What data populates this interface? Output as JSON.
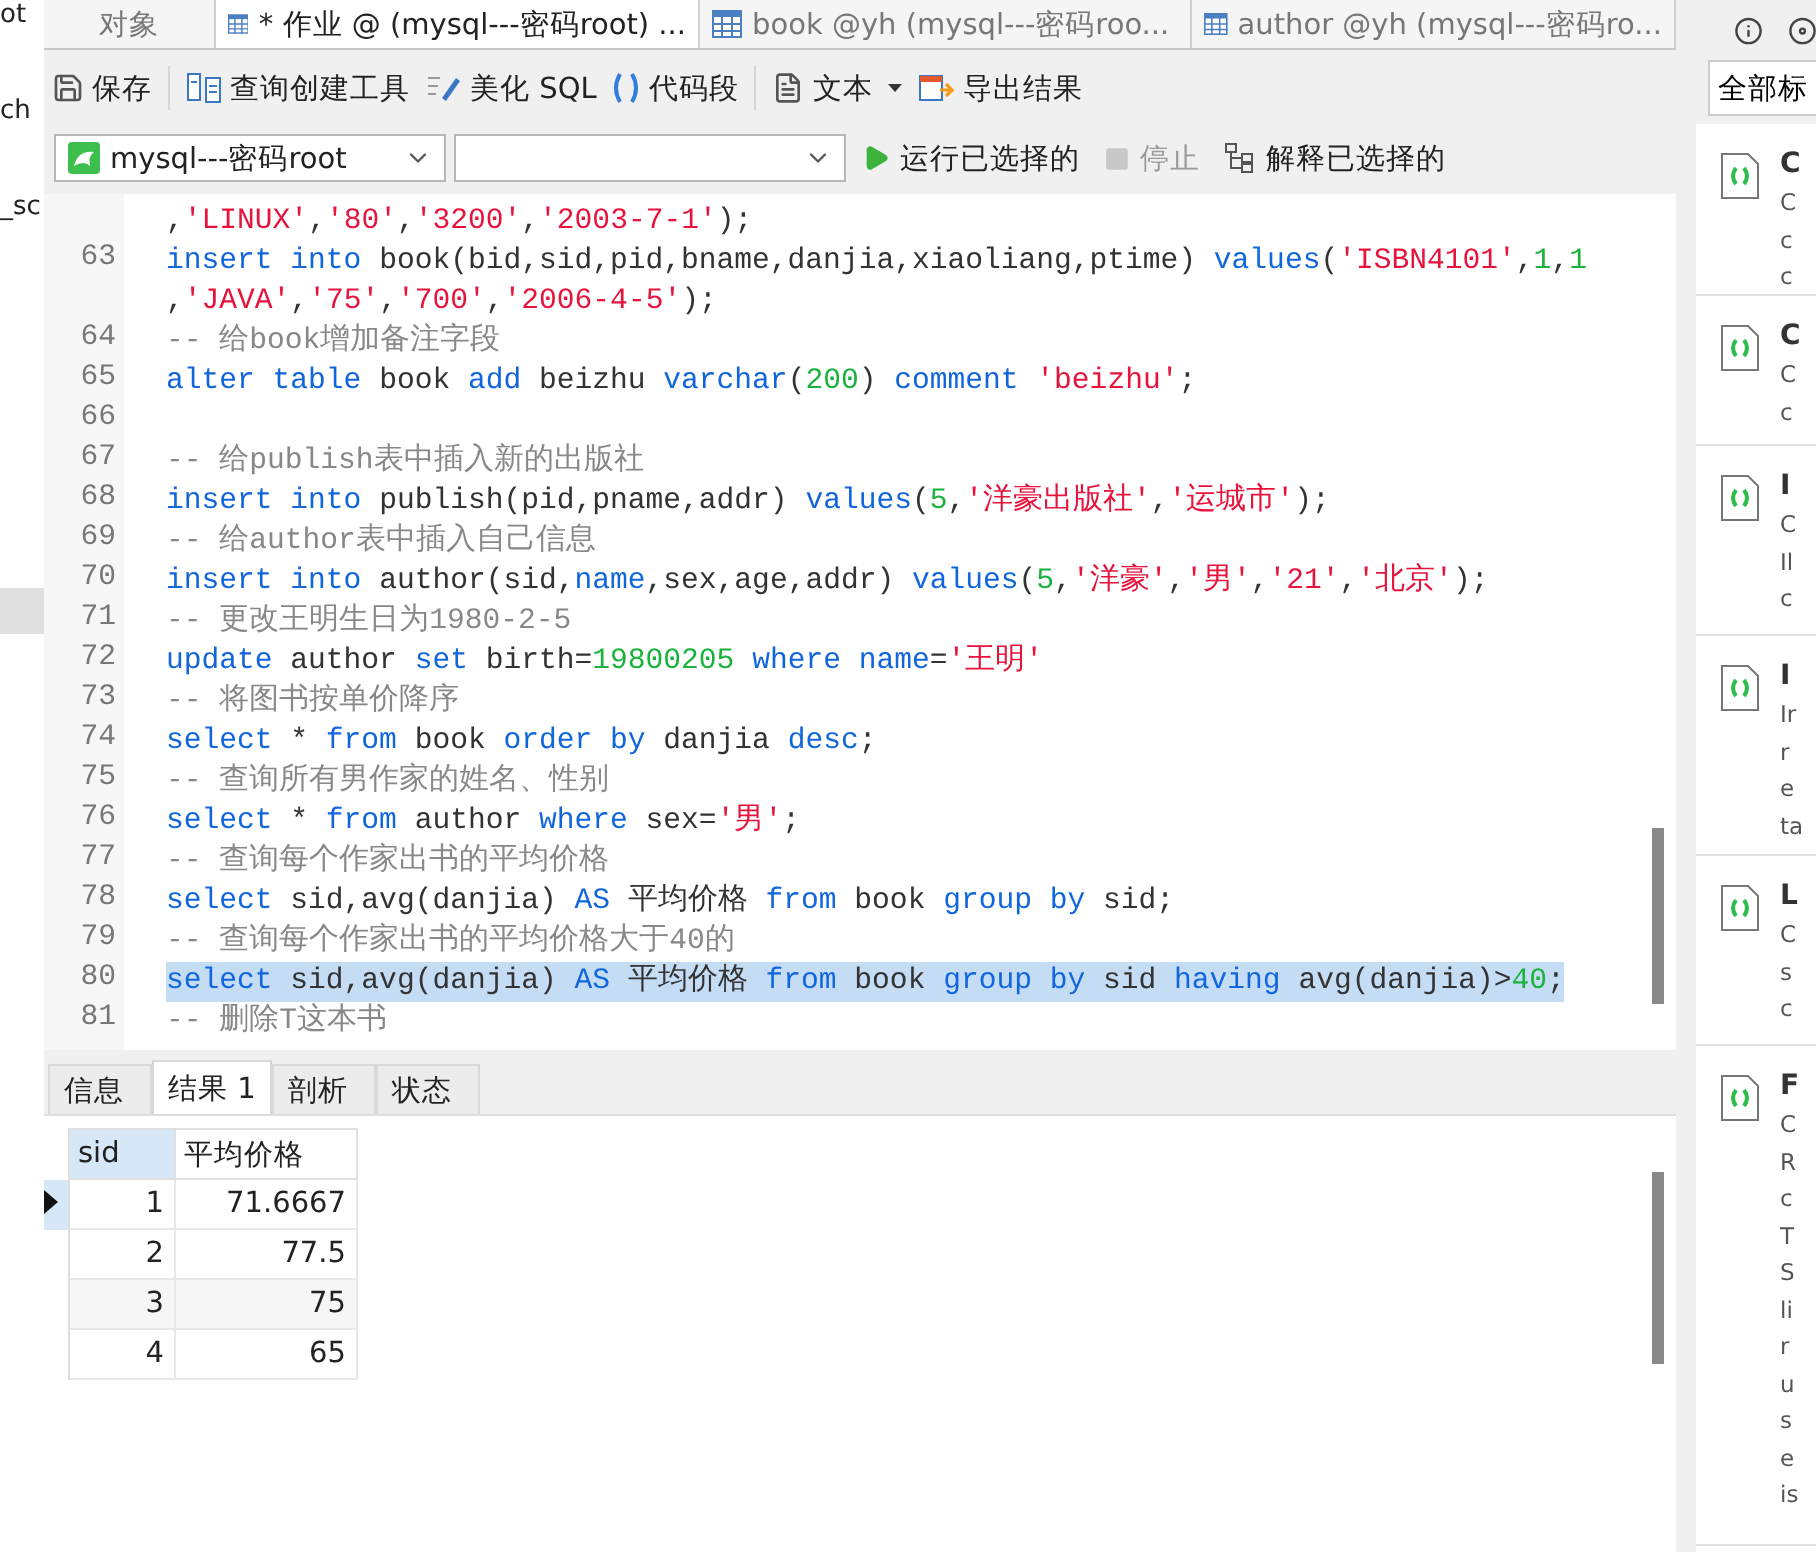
{
  "left_panel": {
    "items": [
      "ot",
      "ch",
      "_sc"
    ]
  },
  "tabs": [
    {
      "label": "对象",
      "kind": "plain",
      "selected": false
    },
    {
      "label": "* 作业 @ (mysql---密码root) ...",
      "kind": "query",
      "selected": true
    },
    {
      "label": "book @yh (mysql---密码roo...",
      "kind": "table",
      "selected": false
    },
    {
      "label": "author @yh (mysql---密码ro...",
      "kind": "table",
      "selected": false
    }
  ],
  "toolbar": {
    "groups": [
      [
        {
          "label": "保存",
          "kind": "save",
          "has_menu": false
        }
      ],
      [
        {
          "label": "查询创建工具",
          "kind": "builder",
          "has_menu": false
        },
        {
          "label": "美化 SQL",
          "kind": "beautify",
          "has_menu": false
        },
        {
          "label": "代码段",
          "kind": "snippet",
          "has_menu": false
        }
      ],
      [
        {
          "label": "文本",
          "kind": "text",
          "has_menu": true
        },
        {
          "label": "导出结果",
          "kind": "export",
          "has_menu": false
        }
      ]
    ]
  },
  "run_bar": {
    "connection": "mysql---密码root",
    "run": {
      "label": "运行已选择的",
      "disabled": false
    },
    "stop": {
      "label": "停止",
      "disabled": true
    },
    "explain": {
      "label": "解释已选择的",
      "disabled": false
    }
  },
  "editor": {
    "lines": [
      {
        "selected": false,
        "tokens": [
          {
            "kind": "plain",
            "text": ","
          },
          {
            "kind": "string",
            "text": "'LINUX'"
          },
          {
            "kind": "plain",
            "text": ","
          },
          {
            "kind": "string",
            "text": "'80'"
          },
          {
            "kind": "plain",
            "text": ","
          },
          {
            "kind": "string",
            "text": "'3200'"
          },
          {
            "kind": "plain",
            "text": ","
          },
          {
            "kind": "string",
            "text": "'2003-7-1'"
          },
          {
            "kind": "plain",
            "text": ");"
          }
        ]
      },
      {
        "number": "63",
        "selected": false,
        "tokens": [
          {
            "kind": "keyword",
            "text": "insert into"
          },
          {
            "kind": "plain",
            "text": " book(bid,sid,pid,bname,danjia,xiaoliang,ptime) "
          },
          {
            "kind": "keyword",
            "text": "values"
          },
          {
            "kind": "plain",
            "text": "("
          },
          {
            "kind": "string",
            "text": "'ISBN4101'"
          },
          {
            "kind": "plain",
            "text": ","
          },
          {
            "kind": "number",
            "text": "1"
          },
          {
            "kind": "plain",
            "text": ","
          },
          {
            "kind": "number",
            "text": "1"
          }
        ]
      },
      {
        "selected": false,
        "tokens": [
          {
            "kind": "plain",
            "text": ","
          },
          {
            "kind": "string",
            "text": "'JAVA'"
          },
          {
            "kind": "plain",
            "text": ","
          },
          {
            "kind": "string",
            "text": "'75'"
          },
          {
            "kind": "plain",
            "text": ","
          },
          {
            "kind": "string",
            "text": "'700'"
          },
          {
            "kind": "plain",
            "text": ","
          },
          {
            "kind": "string",
            "text": "'2006-4-5'"
          },
          {
            "kind": "plain",
            "text": ");"
          }
        ]
      },
      {
        "number": "64",
        "selected": false,
        "tokens": [
          {
            "kind": "comment",
            "text": "-- 给book增加备注字段"
          }
        ]
      },
      {
        "number": "65",
        "selected": false,
        "tokens": [
          {
            "kind": "keyword",
            "text": "alter table"
          },
          {
            "kind": "plain",
            "text": " book "
          },
          {
            "kind": "keyword",
            "text": "add"
          },
          {
            "kind": "plain",
            "text": " beizhu "
          },
          {
            "kind": "keyword",
            "text": "varchar"
          },
          {
            "kind": "plain",
            "text": "("
          },
          {
            "kind": "number",
            "text": "200"
          },
          {
            "kind": "plain",
            "text": ") "
          },
          {
            "kind": "keyword",
            "text": "comment "
          },
          {
            "kind": "string",
            "text": "'beizhu'"
          },
          {
            "kind": "plain",
            "text": ";"
          }
        ]
      },
      {
        "number": "66",
        "selected": false
      },
      {
        "number": "67",
        "selected": false,
        "tokens": [
          {
            "kind": "comment",
            "text": "-- 给publish表中插入新的出版社"
          }
        ]
      },
      {
        "number": "68",
        "selected": false,
        "tokens": [
          {
            "kind": "keyword",
            "text": "insert into"
          },
          {
            "kind": "plain",
            "text": " publish(pid,pname,addr) "
          },
          {
            "kind": "keyword",
            "text": "values"
          },
          {
            "kind": "plain",
            "text": "("
          },
          {
            "kind": "number",
            "text": "5"
          },
          {
            "kind": "plain",
            "text": ","
          },
          {
            "kind": "string",
            "text": "'洋豪出版社'"
          },
          {
            "kind": "plain",
            "text": ","
          },
          {
            "kind": "string",
            "text": "'运城市'"
          },
          {
            "kind": "plain",
            "text": ");"
          }
        ]
      },
      {
        "number": "69",
        "selected": false,
        "tokens": [
          {
            "kind": "comment",
            "text": "-- 给author表中插入自己信息"
          }
        ]
      },
      {
        "number": "70",
        "selected": false,
        "tokens": [
          {
            "kind": "keyword",
            "text": "insert into"
          },
          {
            "kind": "plain",
            "text": " author(sid,"
          },
          {
            "kind": "keyword",
            "text": "name"
          },
          {
            "kind": "plain",
            "text": ",sex,age,addr) "
          },
          {
            "kind": "keyword",
            "text": "values"
          },
          {
            "kind": "plain",
            "text": "("
          },
          {
            "kind": "number",
            "text": "5"
          },
          {
            "kind": "plain",
            "text": ","
          },
          {
            "kind": "string",
            "text": "'洋豪'"
          },
          {
            "kind": "plain",
            "text": ","
          },
          {
            "kind": "string",
            "text": "'男'"
          },
          {
            "kind": "plain",
            "text": ","
          },
          {
            "kind": "string",
            "text": "'21'"
          },
          {
            "kind": "plain",
            "text": ","
          },
          {
            "kind": "string",
            "text": "'北京'"
          },
          {
            "kind": "plain",
            "text": ");"
          }
        ]
      },
      {
        "number": "71",
        "selected": false,
        "tokens": [
          {
            "kind": "comment",
            "text": "-- 更改王明生日为1980-2-5"
          }
        ]
      },
      {
        "number": "72",
        "selected": false,
        "tokens": [
          {
            "kind": "keyword",
            "text": "update"
          },
          {
            "kind": "plain",
            "text": " author "
          },
          {
            "kind": "keyword",
            "text": "set"
          },
          {
            "kind": "plain",
            "text": " birth="
          },
          {
            "kind": "number",
            "text": "19800205"
          },
          {
            "kind": "keyword",
            "text": " where name"
          },
          {
            "kind": "plain",
            "text": "="
          },
          {
            "kind": "string",
            "text": "'王明'"
          }
        ]
      },
      {
        "number": "73",
        "selected": false,
        "tokens": [
          {
            "kind": "comment",
            "text": "-- 将图书按单价降序"
          }
        ]
      },
      {
        "number": "74",
        "selected": false,
        "tokens": [
          {
            "kind": "keyword",
            "text": "select"
          },
          {
            "kind": "plain",
            "text": " * "
          },
          {
            "kind": "keyword",
            "text": "from"
          },
          {
            "kind": "plain",
            "text": " book "
          },
          {
            "kind": "keyword",
            "text": "order by"
          },
          {
            "kind": "plain",
            "text": " danjia "
          },
          {
            "kind": "keyword",
            "text": "desc"
          },
          {
            "kind": "plain",
            "text": ";"
          }
        ]
      },
      {
        "number": "75",
        "selected": false,
        "tokens": [
          {
            "kind": "comment",
            "text": "-- 查询所有男作家的姓名、性别"
          }
        ]
      },
      {
        "number": "76",
        "selected": false,
        "tokens": [
          {
            "kind": "keyword",
            "text": "select"
          },
          {
            "kind": "plain",
            "text": " * "
          },
          {
            "kind": "keyword",
            "text": "from"
          },
          {
            "kind": "plain",
            "text": " author "
          },
          {
            "kind": "keyword",
            "text": "where"
          },
          {
            "kind": "plain",
            "text": " sex="
          },
          {
            "kind": "string",
            "text": "'男'"
          },
          {
            "kind": "plain",
            "text": ";"
          }
        ]
      },
      {
        "number": "77",
        "selected": false,
        "tokens": [
          {
            "kind": "comment",
            "text": "-- 查询每个作家出书的平均价格"
          }
        ]
      },
      {
        "number": "78",
        "selected": false,
        "tokens": [
          {
            "kind": "keyword",
            "text": "select"
          },
          {
            "kind": "plain",
            "text": " sid,avg(danjia) "
          },
          {
            "kind": "keyword",
            "text": "AS"
          },
          {
            "kind": "plain",
            "text": " 平均价格 "
          },
          {
            "kind": "keyword",
            "text": "from"
          },
          {
            "kind": "plain",
            "text": " book "
          },
          {
            "kind": "keyword",
            "text": "group by"
          },
          {
            "kind": "plain",
            "text": " sid;"
          }
        ]
      },
      {
        "number": "79",
        "selected": false,
        "tokens": [
          {
            "kind": "comment",
            "text": "-- 查询每个作家出书的平均价格大于40的"
          }
        ]
      },
      {
        "number": "80",
        "selected": true,
        "tokens": [
          {
            "kind": "keyword",
            "text": "select"
          },
          {
            "kind": "plain",
            "text": " sid,avg(danjia) "
          },
          {
            "kind": "keyword",
            "text": "AS"
          },
          {
            "kind": "plain",
            "text": " 平均价格 "
          },
          {
            "kind": "keyword",
            "text": "from"
          },
          {
            "kind": "plain",
            "text": " book "
          },
          {
            "kind": "keyword",
            "text": "group by"
          },
          {
            "kind": "plain",
            "text": " sid "
          },
          {
            "kind": "keyword",
            "text": "having"
          },
          {
            "kind": "plain",
            "text": " avg(danjia)>"
          },
          {
            "kind": "number",
            "text": "40"
          },
          {
            "kind": "plain",
            "text": ";"
          }
        ]
      },
      {
        "number": "81",
        "selected": false,
        "tokens": [
          {
            "kind": "comment",
            "text": "-- 删除T这本书"
          }
        ]
      }
    ]
  },
  "result_tabs": [
    {
      "label": "信息",
      "selected": false
    },
    {
      "label": "结果 1",
      "selected": true
    },
    {
      "label": "剖析",
      "selected": false
    },
    {
      "label": "状态",
      "selected": false
    }
  ],
  "grid": {
    "columns": [
      {
        "label": "sid",
        "selected": true
      },
      {
        "label": "平均价格",
        "selected": false
      }
    ],
    "rows": [
      {
        "selected": true,
        "cells": [
          "1",
          "71.6667"
        ]
      },
      {
        "selected": false,
        "cells": [
          "2",
          "77.5"
        ]
      },
      {
        "selected": false,
        "cells": [
          "3",
          "75"
        ]
      },
      {
        "selected": false,
        "cells": [
          "4",
          "65"
        ]
      }
    ]
  },
  "snippets_panel": {
    "filter": "全部标",
    "cards": [
      {
        "title": "C",
        "lines": [
          "C",
          "c",
          "c"
        ]
      },
      {
        "title": "C",
        "lines": [
          "C",
          "c"
        ]
      },
      {
        "title": "I",
        "lines": [
          "C",
          "Il",
          "c"
        ]
      },
      {
        "title": "I",
        "lines": [
          "Ir",
          "r",
          "e",
          "ta"
        ]
      },
      {
        "title": "L",
        "lines": [
          "C",
          "s",
          "c"
        ]
      },
      {
        "title": "F",
        "lines": [
          "C",
          "R",
          "c",
          "T",
          "S",
          "li",
          "r",
          "u",
          "s",
          "e",
          "is"
        ]
      }
    ]
  }
}
